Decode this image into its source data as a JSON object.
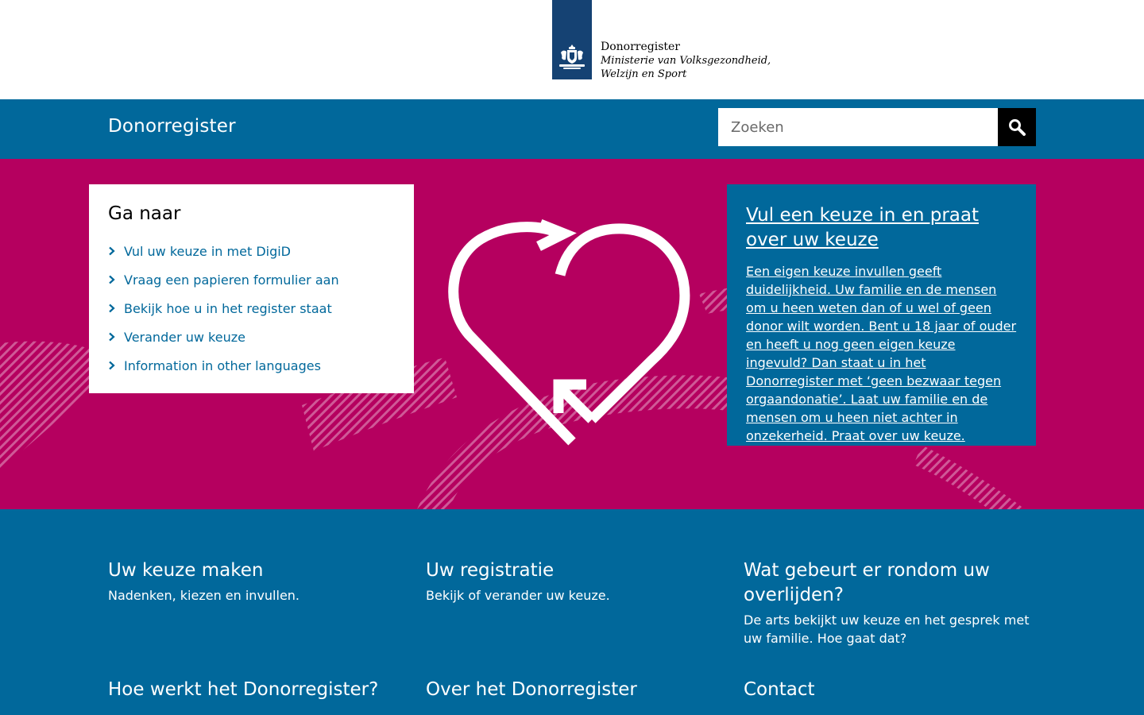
{
  "header": {
    "logo_title": "Donorregister",
    "logo_sub_1": "Ministerie van Volksgezondheid,",
    "logo_sub_2": "Welzijn en Sport"
  },
  "navbar": {
    "site_name": "Donorregister",
    "search_placeholder": "Zoeken",
    "search_icon": "search-icon"
  },
  "goto": {
    "title": "Ga naar",
    "items": [
      {
        "label": "Vul uw keuze in met DigiD"
      },
      {
        "label": "Vraag een papieren formulier aan"
      },
      {
        "label": "Bekijk hoe u in het register staat"
      },
      {
        "label": "Verander uw keuze"
      },
      {
        "label": "Information in other languages"
      }
    ]
  },
  "feature": {
    "title": "Vul een keuze in en praat over uw keuze",
    "text": "Een eigen keuze invullen geeft duidelijkheid. Uw familie en de mensen om u heen weten dan of u wel of geen donor wilt worden. Bent u 18 jaar of ouder en heeft u nog geen eigen keuze ingevuld? Dan staat u in het Donorregister met ‘geen bezwaar tegen orgaandonatie’. Laat uw familie en de mensen om u heen niet achter in onzekerheid. Praat over uw keuze."
  },
  "tiles": [
    {
      "title": "Uw keuze maken",
      "text": "Nadenken, kiezen en invullen."
    },
    {
      "title": "Uw registratie",
      "text": "Bekijk of verander uw keuze."
    },
    {
      "title": "Wat gebeurt er rondom uw overlijden?",
      "text": "De arts bekijkt uw keuze en het gesprek met uw familie. Hoe gaat dat?"
    },
    {
      "title": "Hoe werkt het Donorregister?",
      "text": ""
    },
    {
      "title": "Over het Donorregister",
      "text": ""
    },
    {
      "title": "Contact",
      "text": ""
    }
  ],
  "colors": {
    "brand_blue": "#01689b",
    "logo_blue": "#154273",
    "hero_magenta": "#b5005f"
  }
}
